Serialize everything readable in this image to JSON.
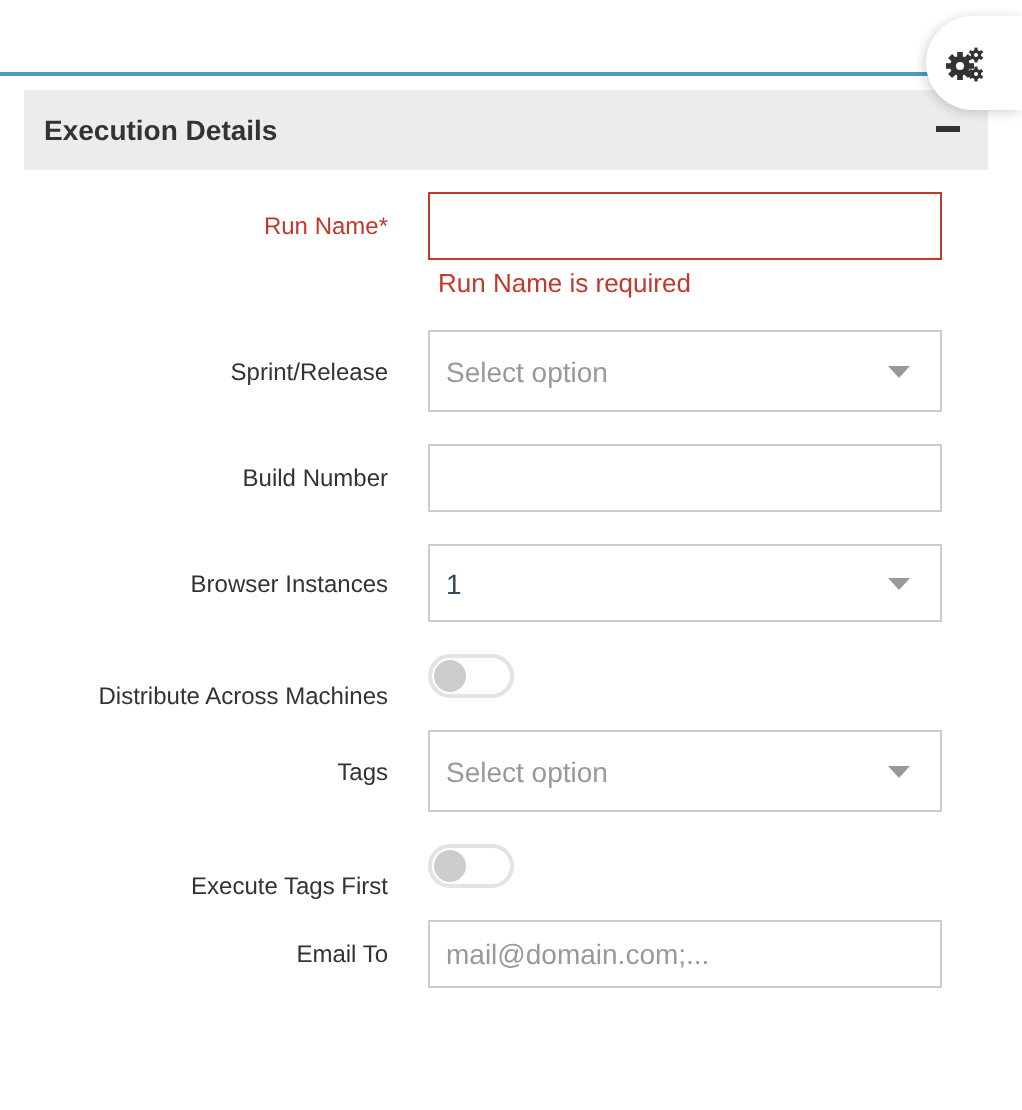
{
  "panel": {
    "title": "Execution Details",
    "expanded": true
  },
  "fields": [
    {
      "kind": "text",
      "label": "Run Name*",
      "invalid": true,
      "error": "Run Name is required"
    },
    {
      "kind": "select",
      "label": "Sprint/Release",
      "placeholder": "Select option"
    },
    {
      "kind": "text",
      "label": "Build Number",
      "invalid": false
    },
    {
      "kind": "select",
      "label": "Browser Instances",
      "value": "1"
    },
    {
      "kind": "toggle",
      "label": "Distribute Across Machines",
      "on": false
    },
    {
      "kind": "select",
      "label": "Tags",
      "placeholder": "Select option"
    },
    {
      "kind": "toggle",
      "label": "Execute Tags First",
      "on": false
    },
    {
      "kind": "text",
      "label": "Email To",
      "placeholder": "mail@domain.com;...",
      "invalid": false
    }
  ]
}
